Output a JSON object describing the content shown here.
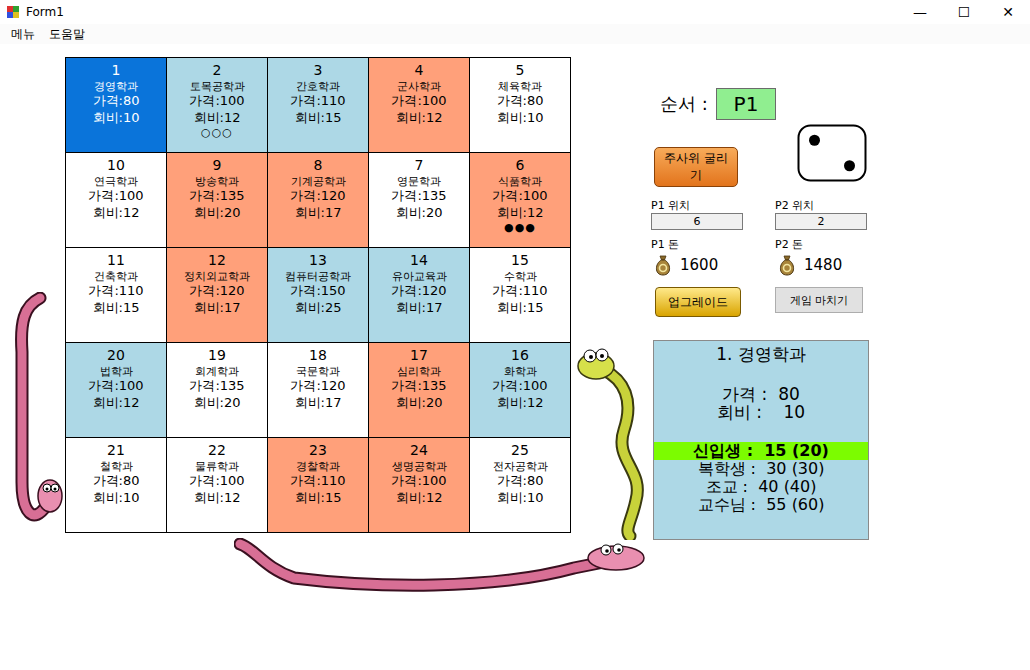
{
  "window": {
    "title": "Form1",
    "controls": [
      "—",
      "☐",
      "✕"
    ]
  },
  "menu": [
    "메뉴",
    "도움말"
  ],
  "board": {
    "cells": [
      {
        "number": "1",
        "name": "경영학과",
        "price": "가격:80",
        "fee": "회비:10",
        "color": "#0a74da",
        "selected": true
      },
      {
        "number": "2",
        "name": "토목공학과",
        "price": "가격:100",
        "fee": "회비:12",
        "color": "#add8e6",
        "selected": false,
        "tokens": "○○○"
      },
      {
        "number": "3",
        "name": "간호학과",
        "price": "가격:110",
        "fee": "회비:15",
        "color": "#add8e6",
        "selected": false
      },
      {
        "number": "4",
        "name": "군사학과",
        "price": "가격:100",
        "fee": "회비:12",
        "color": "#ffa07a",
        "selected": false
      },
      {
        "number": "5",
        "name": "체육학과",
        "price": "가격:80",
        "fee": "회비:10",
        "color": "#ffffff",
        "selected": false
      },
      {
        "number": "10",
        "name": "연극학과",
        "price": "가격:100",
        "fee": "회비:12",
        "color": "#ffffff",
        "selected": false
      },
      {
        "number": "9",
        "name": "방송학과",
        "price": "가격:135",
        "fee": "회비:20",
        "color": "#ffa07a",
        "selected": false
      },
      {
        "number": "8",
        "name": "기계공학과",
        "price": "가격:120",
        "fee": "회비:17",
        "color": "#ffa07a",
        "selected": false
      },
      {
        "number": "7",
        "name": "영문학과",
        "price": "가격:135",
        "fee": "회비:20",
        "color": "#ffffff",
        "selected": false
      },
      {
        "number": "6",
        "name": "식품학과",
        "price": "가격:100",
        "fee": "회비:12",
        "color": "#ffa07a",
        "selected": false,
        "tokens": "●●●"
      },
      {
        "number": "11",
        "name": "건축학과",
        "price": "가격:110",
        "fee": "회비:15",
        "color": "#ffffff",
        "selected": false
      },
      {
        "number": "12",
        "name": "정치외교학과",
        "price": "가격:120",
        "fee": "회비:17",
        "color": "#ffa07a",
        "selected": false
      },
      {
        "number": "13",
        "name": "컴퓨터공학과",
        "price": "가격:150",
        "fee": "회비:25",
        "color": "#add8e6",
        "selected": false
      },
      {
        "number": "14",
        "name": "유아교육과",
        "price": "가격:120",
        "fee": "회비:17",
        "color": "#add8e6",
        "selected": false
      },
      {
        "number": "15",
        "name": "수학과",
        "price": "가격:110",
        "fee": "회비:15",
        "color": "#ffffff",
        "selected": false
      },
      {
        "number": "20",
        "name": "법학과",
        "price": "가격:100",
        "fee": "회비:12",
        "color": "#add8e6",
        "selected": false
      },
      {
        "number": "19",
        "name": "회계학과",
        "price": "가격:135",
        "fee": "회비:20",
        "color": "#ffffff",
        "selected": false
      },
      {
        "number": "18",
        "name": "국문학과",
        "price": "가격:120",
        "fee": "회비:17",
        "color": "#ffffff",
        "selected": false
      },
      {
        "number": "17",
        "name": "심리학과",
        "price": "가격:135",
        "fee": "회비:20",
        "color": "#ffa07a",
        "selected": false
      },
      {
        "number": "16",
        "name": "화학과",
        "price": "가격:100",
        "fee": "회비:12",
        "color": "#add8e6",
        "selected": false
      },
      {
        "number": "21",
        "name": "철학과",
        "price": "가격:80",
        "fee": "회비:10",
        "color": "#ffffff",
        "selected": false
      },
      {
        "number": "22",
        "name": "물류학과",
        "price": "가격:100",
        "fee": "회비:12",
        "color": "#ffffff",
        "selected": false
      },
      {
        "number": "23",
        "name": "경찰학과",
        "price": "가격:110",
        "fee": "회비:15",
        "color": "#ffa07a",
        "selected": false
      },
      {
        "number": "24",
        "name": "생명공학과",
        "price": "가격:100",
        "fee": "회비:12",
        "color": "#ffa07a",
        "selected": false
      },
      {
        "number": "25",
        "name": "전자공학과",
        "price": "가격:80",
        "fee": "회비:10",
        "color": "#ffffff",
        "selected": false
      }
    ]
  },
  "turn": {
    "label": "순서 :",
    "player": "P1"
  },
  "dice": {
    "button": "주사위 굴리기",
    "value": 2
  },
  "players": [
    {
      "position_label": "P1 위치",
      "position": "6",
      "money_label": "P1 돈",
      "money": "1600"
    },
    {
      "position_label": "P2 위치",
      "position": "2",
      "money_label": "P2 돈",
      "money": "1480"
    }
  ],
  "buttons": {
    "upgrade": "업그레이드",
    "end": "게임 마치기"
  },
  "info": {
    "title": "1. 경영학과",
    "price": "가격 :  80",
    "fee": "회비 :    10",
    "levels": [
      {
        "text": "신입생 :  15 (20)",
        "selected": true
      },
      {
        "text": "복학생 :  30 (30)",
        "selected": false
      },
      {
        "text": "조교 :  40 (40)",
        "selected": false
      },
      {
        "text": "교수님 :  55 (60)",
        "selected": false
      }
    ]
  }
}
